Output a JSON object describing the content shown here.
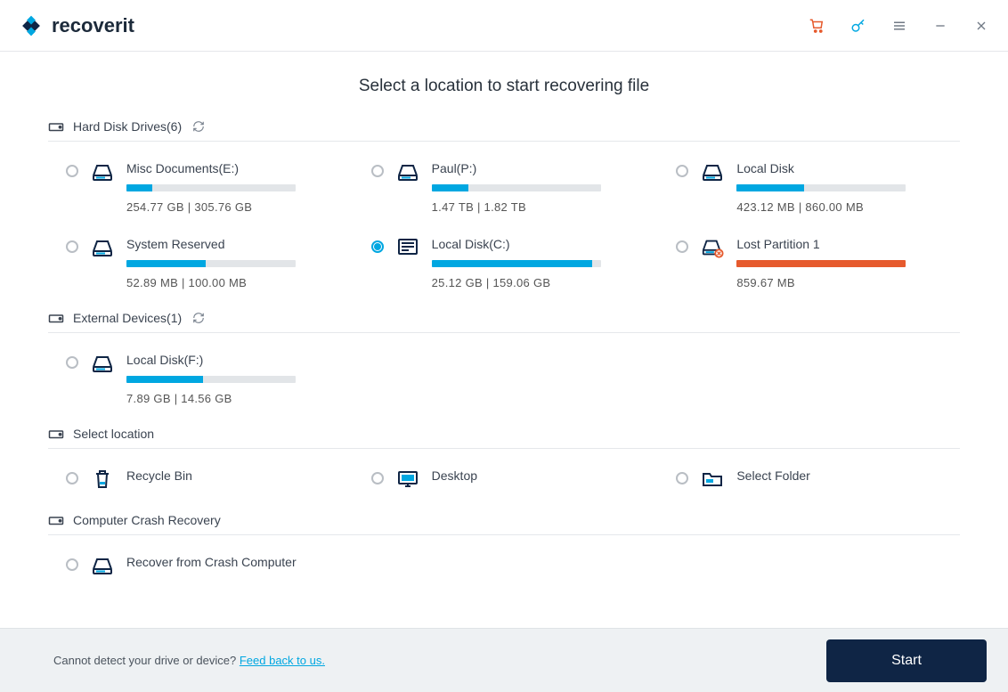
{
  "app": {
    "logo_text": "recoverit"
  },
  "page_title": "Select a location to start recovering file",
  "sections": {
    "hdd": {
      "label": "Hard Disk Drives(6)"
    },
    "ext": {
      "label": "External Devices(1)"
    },
    "loc": {
      "label": "Select location"
    },
    "crash": {
      "label": "Computer Crash Recovery"
    }
  },
  "drives": {
    "e": {
      "label": "Misc Documents(E:)",
      "size": "254.77  GB | 305.76  GB",
      "fill": 15
    },
    "p": {
      "label": "Paul(P:)",
      "size": "1.47  TB | 1.82  TB",
      "fill": 22
    },
    "local": {
      "label": "Local Disk",
      "size": "423.12  MB | 860.00  MB",
      "fill": 40
    },
    "sys": {
      "label": "System Reserved",
      "size": "52.89  MB | 100.00  MB",
      "fill": 47
    },
    "c": {
      "label": "Local Disk(C:)",
      "size": "25.12  GB | 159.06  GB",
      "fill": 95
    },
    "lost": {
      "label": "Lost Partition 1",
      "size": "859.67  MB",
      "fill": 100
    },
    "f": {
      "label": "Local Disk(F:)",
      "size": "7.89  GB | 14.56  GB",
      "fill": 45
    }
  },
  "locations": {
    "recycle": {
      "label": "Recycle Bin"
    },
    "desktop": {
      "label": "Desktop"
    },
    "folder": {
      "label": "Select Folder"
    }
  },
  "crash": {
    "recover": {
      "label": "Recover from Crash Computer"
    }
  },
  "footer": {
    "text": "Cannot detect your drive or device? ",
    "link": "Feed back to us.",
    "start": "Start"
  }
}
